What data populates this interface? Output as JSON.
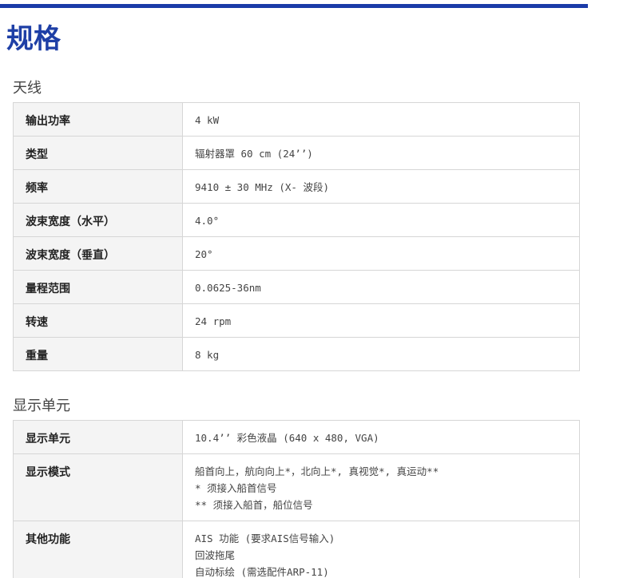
{
  "page": {
    "title": "规格"
  },
  "sections": [
    {
      "heading": "天线",
      "rows": [
        {
          "label": "输出功率",
          "value": [
            "4 kW"
          ]
        },
        {
          "label": "类型",
          "value": [
            "辐射器罩 60 cm (24’’)"
          ]
        },
        {
          "label": "频率",
          "value": [
            "9410 ± 30 MHz (X- 波段)"
          ]
        },
        {
          "label": "波束宽度（水平）",
          "value": [
            "4.0°"
          ]
        },
        {
          "label": "波束宽度（垂直）",
          "value": [
            "20°"
          ]
        },
        {
          "label": "量程范围",
          "value": [
            "0.0625-36nm"
          ]
        },
        {
          "label": "转速",
          "value": [
            "24 rpm"
          ]
        },
        {
          "label": "重量",
          "value": [
            "8 kg"
          ]
        }
      ]
    },
    {
      "heading": "显示单元",
      "rows": [
        {
          "label": "显示单元",
          "value": [
            "10.4’’ 彩色液晶 (640 x 480, VGA)"
          ]
        },
        {
          "label": "显示模式",
          "value": [
            "船首向上，航向向上*，北向上*, 真视觉*, 真运动**",
            "* 须接入船首信号",
            "** 须接入船首，船位信号"
          ]
        },
        {
          "label": "其他功能",
          "value": [
            "AIS 功能 (要求AIS信号输入)",
            "回波拖尾",
            "自动标绘 (需选配件ARP-11)"
          ]
        }
      ]
    }
  ]
}
